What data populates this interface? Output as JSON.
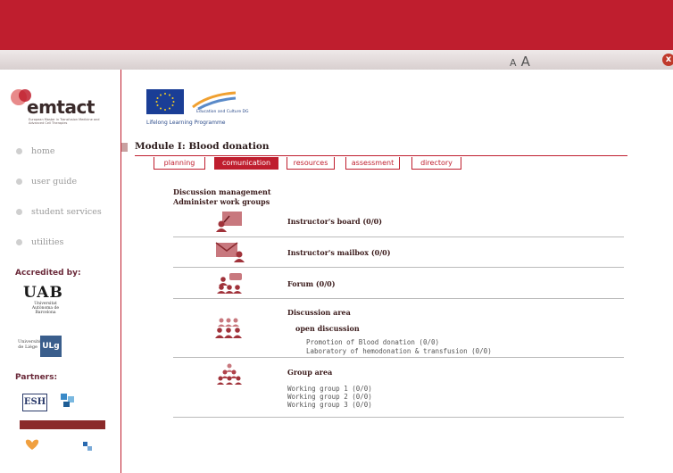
{
  "toolbar": {
    "font_small": "A",
    "font_large": "A",
    "close_label": "x"
  },
  "logos": {
    "emtact_name": "emtact",
    "emtact_tagline": "European Master in Transfusion Medicine and Advanced Cell Therapies",
    "eu_caption": "Education and Culture DG",
    "llp": "Lifelong Learning Programme",
    "uab_name": "UAB",
    "uab_sub": "Universitat Autònoma de Barcelona",
    "liege_name": "Université de Liège",
    "liege_logo": "ULg",
    "esh_logo": "ESH"
  },
  "sidebar": {
    "nav": [
      {
        "label": "home"
      },
      {
        "label": "user guide"
      },
      {
        "label": "student services"
      },
      {
        "label": "utilities"
      }
    ],
    "accredited_heading": "Accredited by:",
    "partners_heading": "Partners:"
  },
  "main": {
    "module_title": "Module I: Blood donation",
    "tabs": [
      {
        "label": "planning",
        "active": false
      },
      {
        "label": "comunication",
        "active": true
      },
      {
        "label": "resources",
        "active": false
      },
      {
        "label": "assessment",
        "active": false
      },
      {
        "label": "directory",
        "active": false
      }
    ],
    "discussion_management": "Discussion management",
    "administer_groups": "Administer work groups",
    "rows": {
      "board": "Instructor's board (0/0)",
      "mailbox": "Instructor's mailbox (0/0)",
      "forum": "Forum (0/0)",
      "discussion_area": "Discussion area",
      "open_discussion": "open discussion",
      "discussions": [
        "Promotion of Blood donation (0/0)",
        "Laboratory of hemodonation & transfusion (0/0)"
      ],
      "group_area": "Group area",
      "groups": [
        "Working group 1 (0/0)",
        "Working group 2 (0/0)",
        "Working group 3 (0/0)"
      ]
    }
  },
  "colors": {
    "brand": "#bf1e2e",
    "icon": "#b0424a",
    "text_dark": "#3a1a1a"
  }
}
